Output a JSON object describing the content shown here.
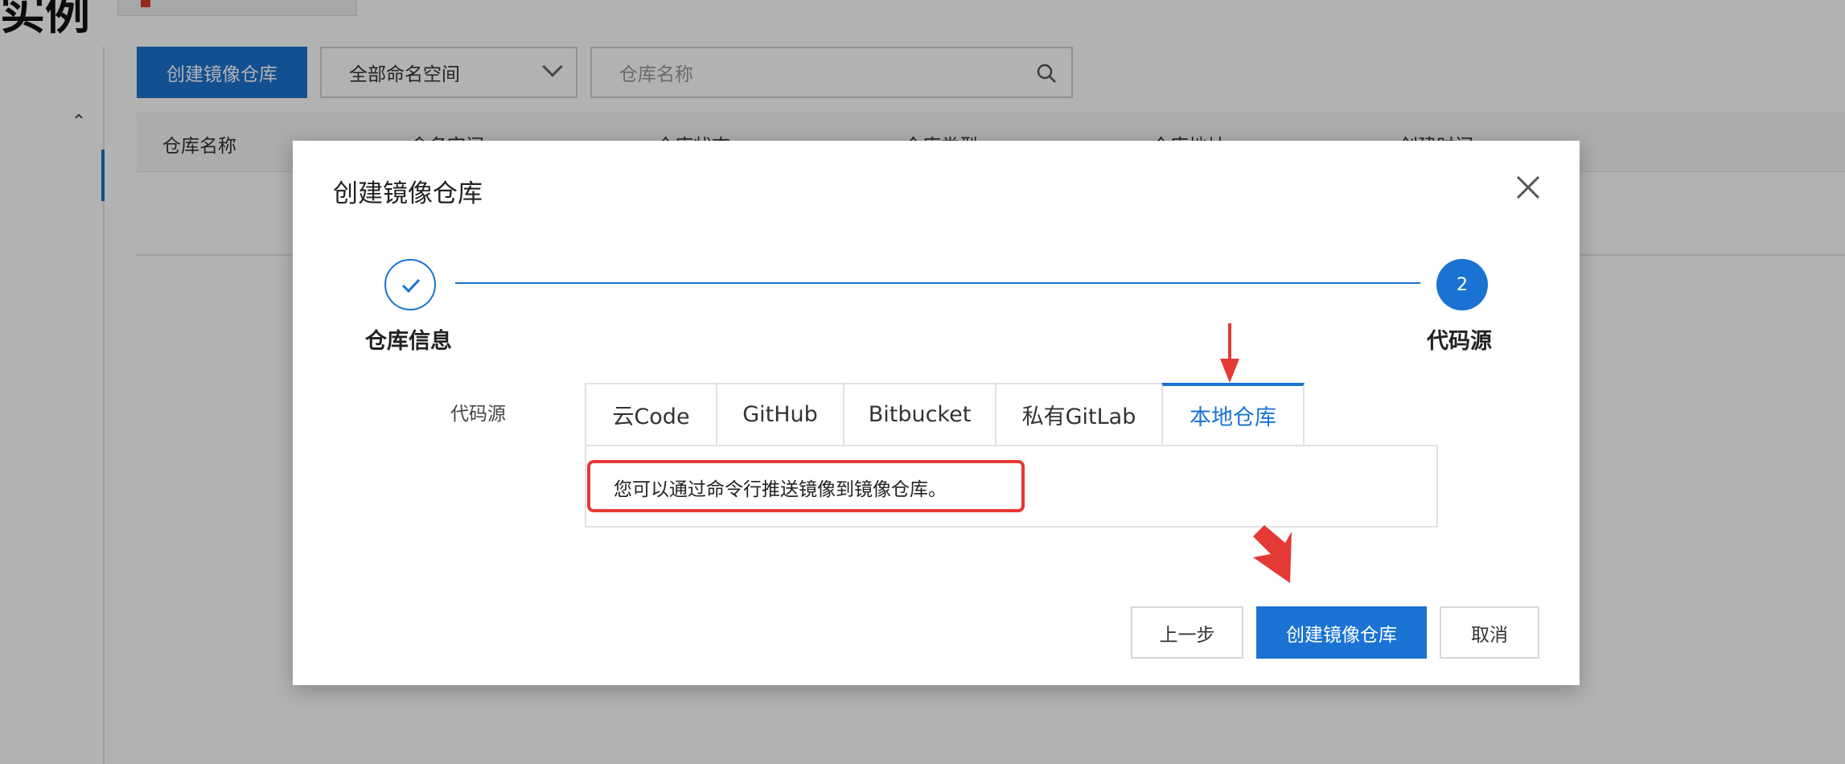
{
  "background": {
    "page_title": "实例",
    "create_repo_button": "创建镜像仓库",
    "namespace_select": "全部命名空间",
    "search_placeholder": "仓库名称",
    "table_headers": [
      "仓库名称",
      "命名空间",
      "仓库状态",
      "仓库类型",
      "仓库地址",
      "创建时间"
    ]
  },
  "modal": {
    "title": "创建镜像仓库",
    "steps": [
      {
        "label": "仓库信息",
        "status": "done"
      },
      {
        "label": "代码源",
        "number": "2",
        "status": "current"
      }
    ],
    "field_label": "代码源",
    "tabs": [
      {
        "label": "云Code",
        "active": false
      },
      {
        "label": "GitHub",
        "active": false
      },
      {
        "label": "Bitbucket",
        "active": false
      },
      {
        "label": "私有GitLab",
        "active": false
      },
      {
        "label": "本地仓库",
        "active": true
      }
    ],
    "panel_text": "您可以通过命令行推送镜像到镜像仓库。",
    "buttons": {
      "prev": "上一步",
      "create": "创建镜像仓库",
      "cancel": "取消"
    }
  },
  "colors": {
    "primary": "#1a73d2",
    "annotation_red": "#e53935"
  }
}
